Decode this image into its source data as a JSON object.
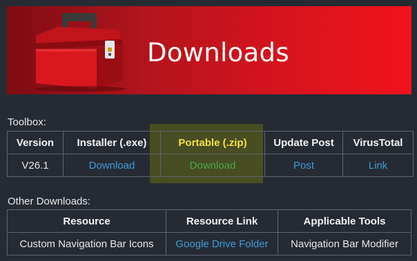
{
  "banner": {
    "title": "Downloads",
    "icon": "toolbox-icon"
  },
  "toolbox": {
    "label": "Toolbox:",
    "headers": [
      "Version",
      "Installer (.exe)",
      "Portable (.zip)",
      "Update Post",
      "VirusTotal"
    ],
    "row": {
      "version": "V26.1",
      "installer": "Download",
      "portable": "Download",
      "update_post": "Post",
      "virustotal": "Link"
    }
  },
  "other": {
    "label": "Other Downloads:",
    "headers": [
      "Resource",
      "Resource Link",
      "Applicable Tools"
    ],
    "row": {
      "resource": "Custom Navigation Bar Icons",
      "link": "Google Drive Folder",
      "tools": "Navigation Bar Modifier"
    }
  },
  "colors": {
    "background": "#262b33",
    "link": "#3d9bd9",
    "highlight_header": "#f2e24a",
    "highlight_link": "#49a84a",
    "banner_red": "#d8141e"
  }
}
